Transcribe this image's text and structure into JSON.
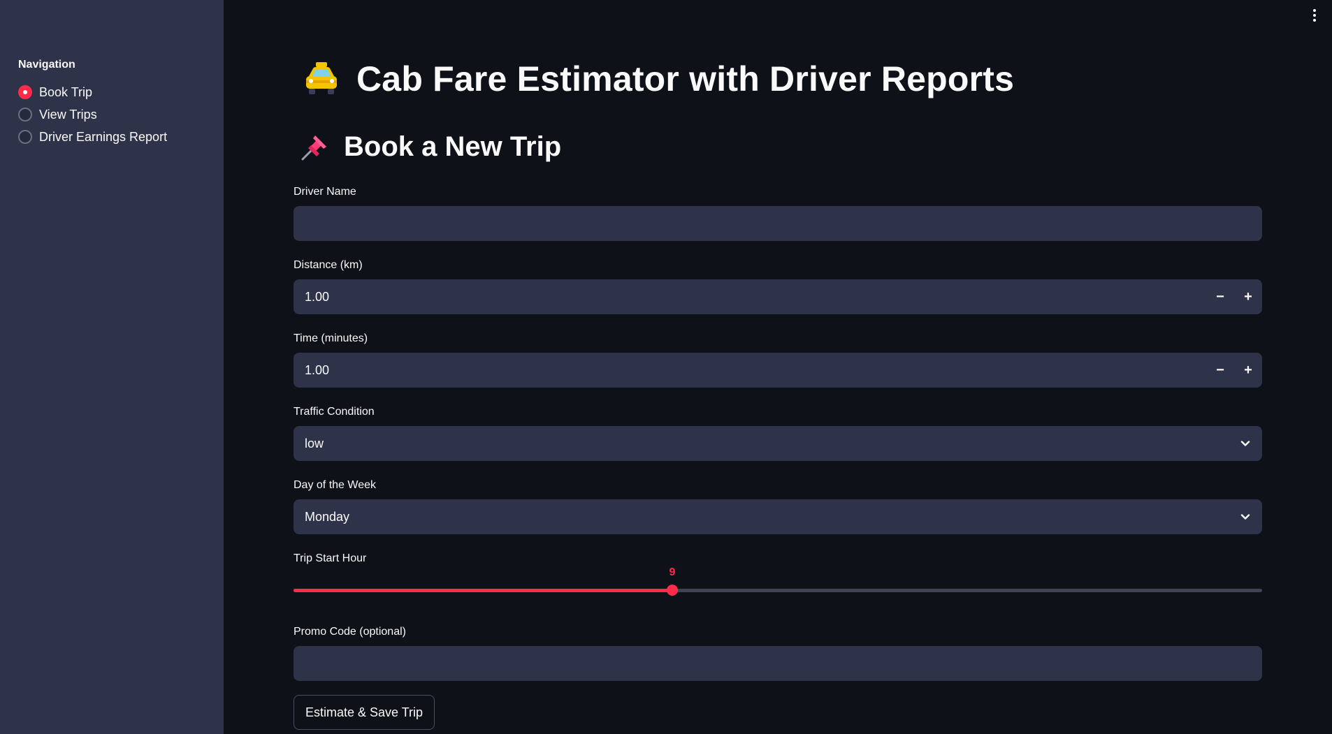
{
  "sidebar": {
    "nav_title": "Navigation",
    "items": [
      {
        "label": "Book Trip",
        "selected": true
      },
      {
        "label": "View Trips",
        "selected": false
      },
      {
        "label": "Driver Earnings Report",
        "selected": false
      }
    ]
  },
  "header": {
    "title": "Cab Fare Estimator with Driver Reports",
    "title_icon": "taxi-icon"
  },
  "section": {
    "title": "Book a New Trip",
    "title_icon": "pushpin-icon"
  },
  "form": {
    "driver_name": {
      "label": "Driver Name",
      "value": ""
    },
    "distance": {
      "label": "Distance (km)",
      "value": "1.00",
      "minus": "−",
      "plus": "+"
    },
    "time": {
      "label": "Time (minutes)",
      "value": "1.00",
      "minus": "−",
      "plus": "+"
    },
    "traffic": {
      "label": "Traffic Condition",
      "value": "low"
    },
    "day": {
      "label": "Day of the Week",
      "value": "Monday"
    },
    "start_hour": {
      "label": "Trip Start Hour",
      "value": "9",
      "fraction": 0.391
    },
    "promo": {
      "label": "Promo Code (optional)",
      "value": ""
    },
    "submit_label": "Estimate & Save Trip"
  },
  "colors": {
    "accent": "#ff2b4b",
    "background": "#0e1117",
    "sidebar": "#2f3349",
    "input": "#2f3349"
  }
}
